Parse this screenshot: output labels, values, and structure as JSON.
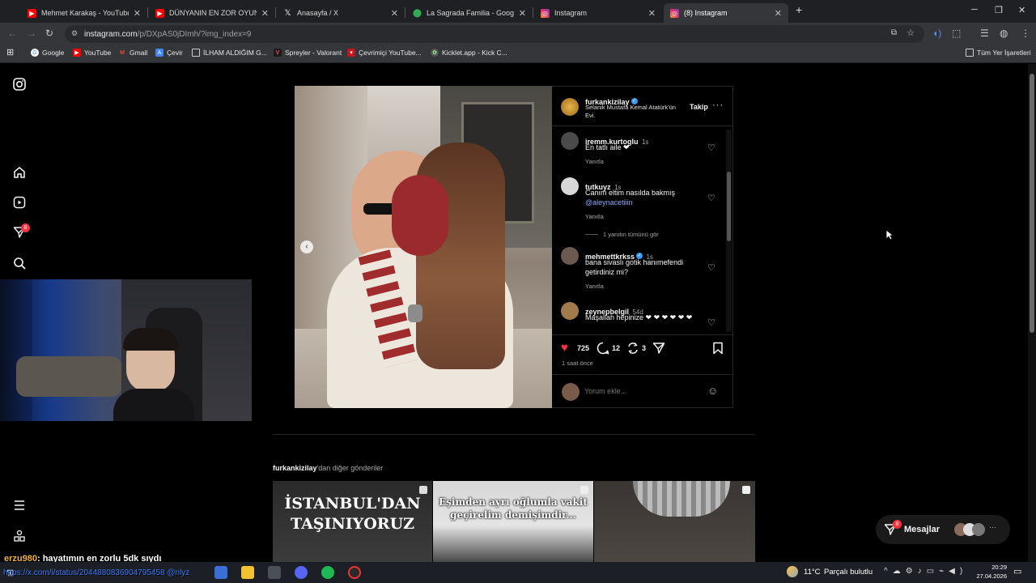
{
  "browser": {
    "tabs": [
      {
        "title": "Mehmet Karakaş - YouTube",
        "icon": "youtube-icon",
        "active": false
      },
      {
        "title": "DÜNYANIN EN ZOR OYUNU!! |",
        "icon": "youtube-icon",
        "active": false
      },
      {
        "title": "Anasayfa / X",
        "icon": "x-icon",
        "active": false
      },
      {
        "title": "La Sagrada Familia - Google Ha",
        "icon": "maps-pin-icon",
        "active": false
      },
      {
        "title": "Instagram",
        "icon": "instagram-icon",
        "active": false
      },
      {
        "title": "(8) Instagram",
        "icon": "instagram-icon",
        "active": true
      }
    ],
    "url_host": "instagram.com",
    "url_path": "/p/DXpAS0jDImh/?img_index=9",
    "bookmarks": [
      {
        "label": "Google",
        "icon": "google-icon"
      },
      {
        "label": "YouTube",
        "icon": "youtube-icon"
      },
      {
        "label": "Gmail",
        "icon": "gmail-icon"
      },
      {
        "label": "Çevir",
        "icon": "translate-icon"
      },
      {
        "label": "İLHAM ALDIĞIM G...",
        "icon": "folder-icon"
      },
      {
        "label": "Spreyler - Valorant",
        "icon": "valorant-icon"
      },
      {
        "label": "Çevrimiçi YouTube...",
        "icon": "tool-icon"
      },
      {
        "label": "Kicklet.app - Kick C...",
        "icon": "kicklet-icon"
      }
    ],
    "all_bookmarks": "Tüm Yer İşaretleri"
  },
  "nav": {
    "notifications_badge": "8"
  },
  "post": {
    "author": "furkankizilay",
    "location": "Selanik Mustafa Kemal Atatürk'ün Evi.",
    "follow": "Takip",
    "more": "···",
    "comments": [
      {
        "user": "iremm.kurtoglu",
        "time": "1s",
        "text": "En tatlı aile ❤",
        "reply": "Yanıtla"
      },
      {
        "user": "tutkuyz",
        "time": "1s",
        "text": "Canım eltim nasılda bakmış",
        "mention": "@aleynacetiiin",
        "reply": "Yanıtla",
        "view_replies": "1 yanıtın tümünü gör"
      },
      {
        "user": "mehmettkrkss",
        "time": "1s",
        "text": "bana sivaslı gotik hanımefendi getirdiniz mi?",
        "reply": "Yanıtla"
      },
      {
        "user": "zeynepbelgil",
        "time": "54d",
        "text": "Maşallah hepinize ❤ ❤ ❤ ❤ ❤ ❤"
      }
    ],
    "likes": "725",
    "comment_count": "12",
    "repost_count": "3",
    "posted_ago": "1 saat önce",
    "comment_placeholder": "Yorum ekle..."
  },
  "more_posts": {
    "username": "furkankizilay",
    "suffix": "'dan diğer gönderiler",
    "thumbnails": [
      {
        "text": "İSTANBUL'DAN TAŞINIYORUZ"
      },
      {
        "text": "Eşimden ayrı oğlumla vakit geçirelim demişimdir..."
      },
      {
        "text": ""
      }
    ]
  },
  "messages": {
    "label": "Mesajlar",
    "badge": "8"
  },
  "overlay": {
    "chat_user": "erzu980",
    "chat_message": ": hayatımın en zorlu 5dk sıydı",
    "link_text": "https://x.com/i/status/2044880836904795458 @nlyz"
  },
  "taskbar": {
    "weather": "11°C",
    "weather_desc": "Parçalı bulutlu",
    "time": "20:29",
    "date": "27.04.2026"
  }
}
